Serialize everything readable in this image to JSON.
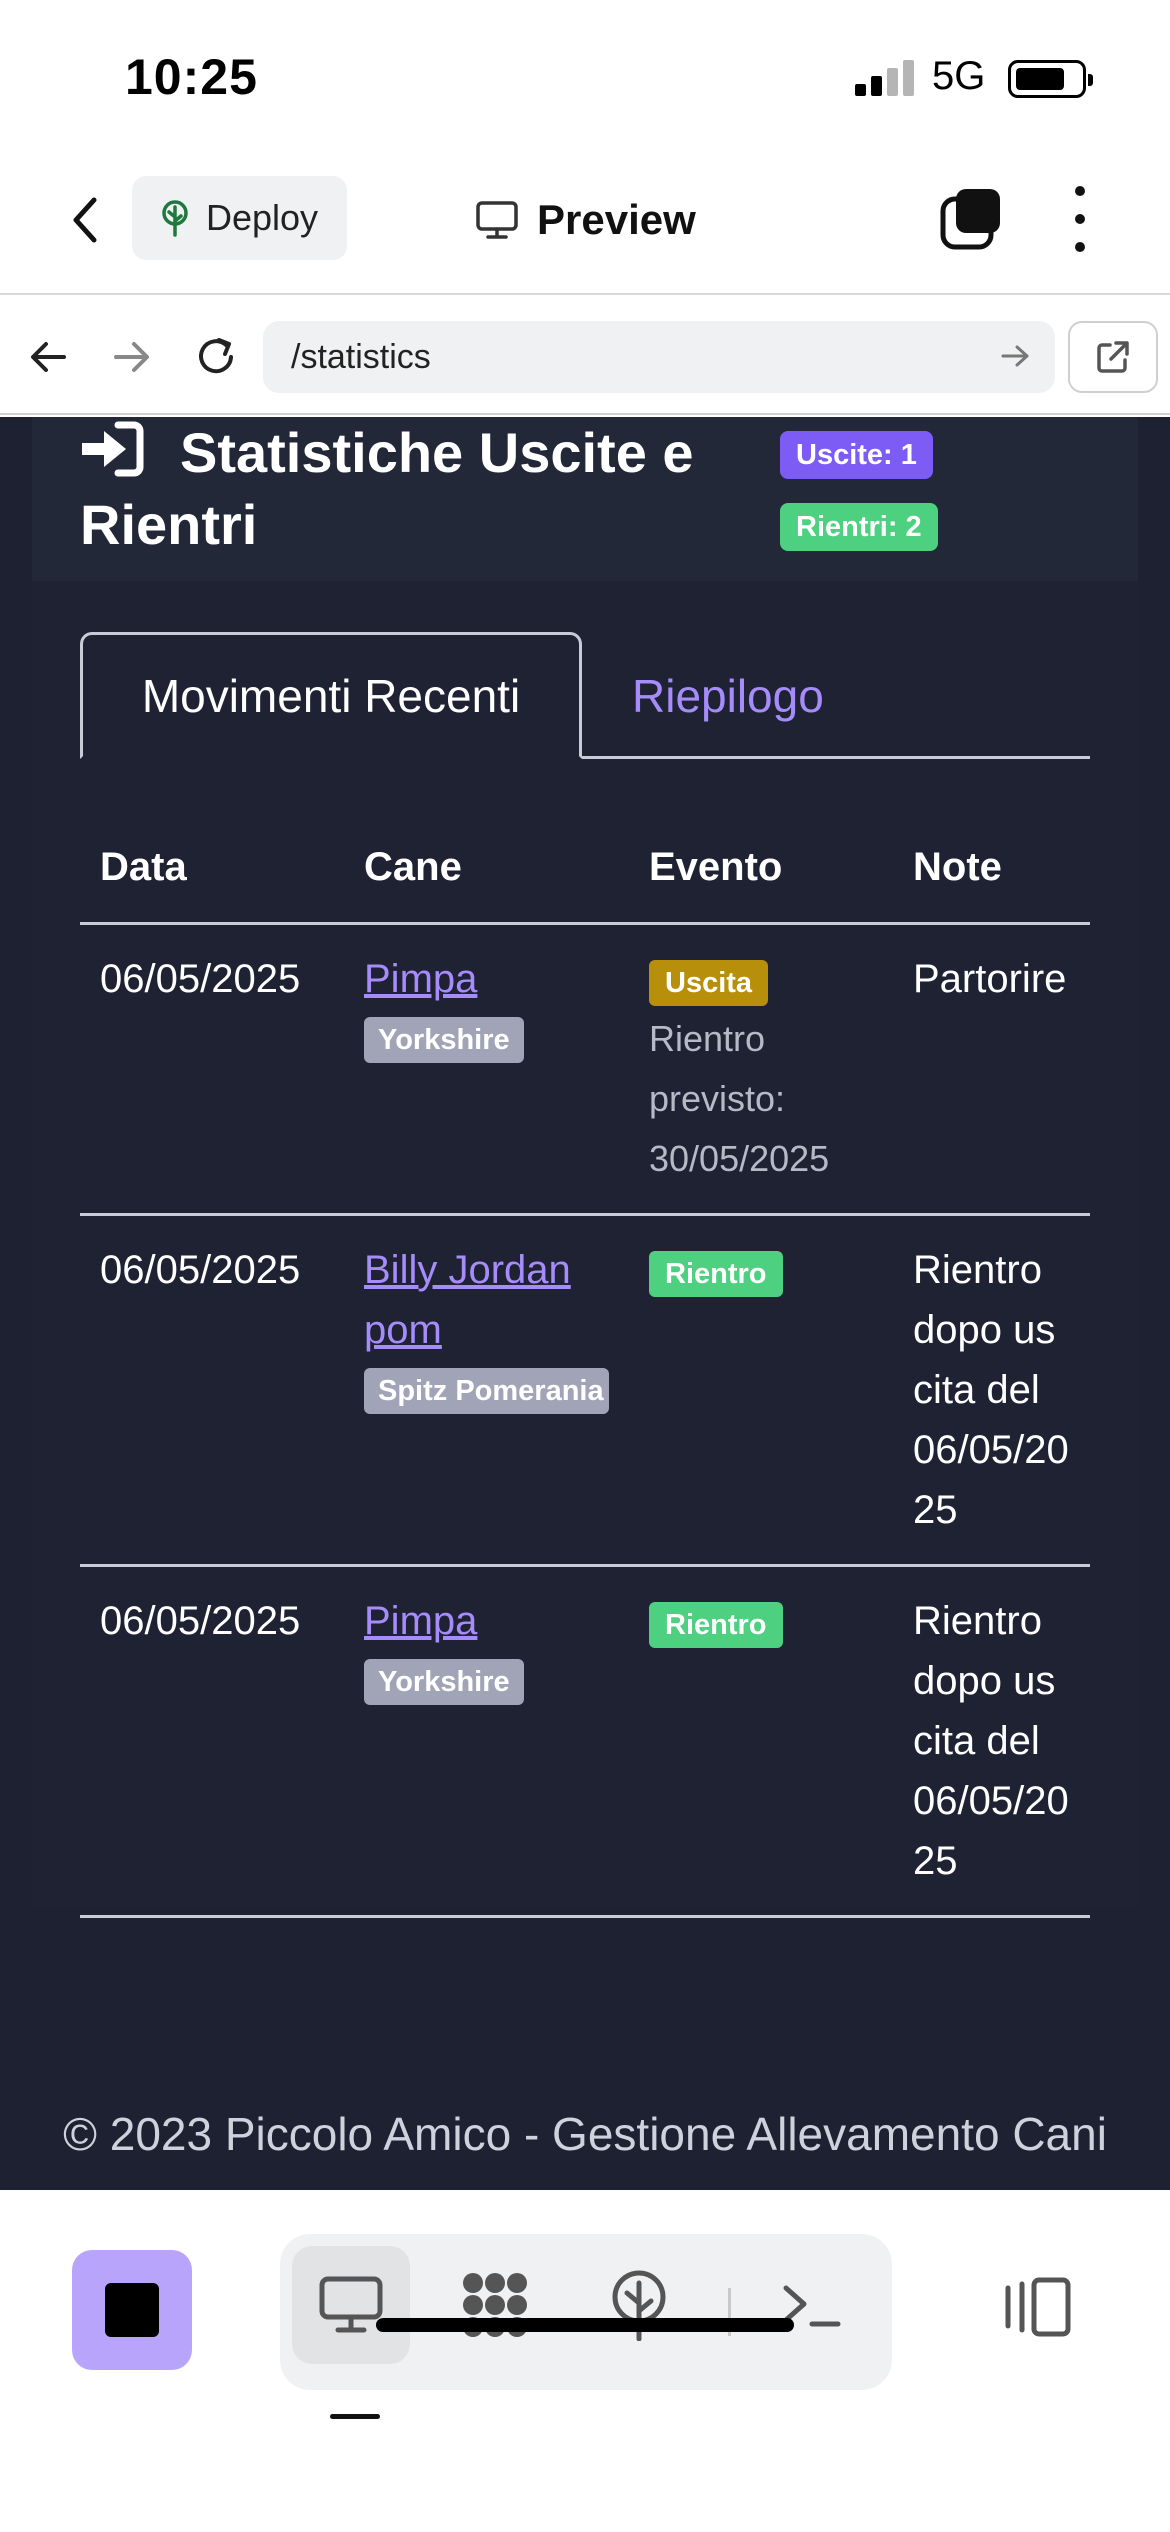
{
  "status_bar": {
    "time": "10:25",
    "network": "5G"
  },
  "app_toolbar": {
    "deploy_label": "Deploy",
    "preview_label": "Preview"
  },
  "browser": {
    "url": "/statistics"
  },
  "card": {
    "title": "Statistiche Uscite e Rientri",
    "badge_uscite": "Uscite: 1",
    "badge_rientri": "Rientri: 2"
  },
  "tabs": {
    "active": "Movimenti Recenti",
    "inactive": "Riepilogo"
  },
  "table": {
    "headers": [
      "Data",
      "Cane",
      "Evento",
      "Note"
    ],
    "rows": [
      {
        "date": "06/05/2025",
        "dog": "Pimpa",
        "breed": "Yorkshire",
        "event": "Uscita",
        "event_sub": "Rientro previsto: 30/05/2025",
        "note": "Partorire"
      },
      {
        "date": "06/05/2025",
        "dog": "Billy Jordan pom",
        "breed": "Spitz Pomerania",
        "event": "Rientro",
        "event_sub": "",
        "note": "Rientro dopo uscita del 06/05/2025"
      },
      {
        "date": "06/05/2025",
        "dog": "Pimpa",
        "breed": "Yorkshire",
        "event": "Rientro",
        "event_sub": "",
        "note": "Rientro dopo uscita del 06/05/2025"
      }
    ]
  },
  "footer": "© 2023 Piccolo Amico - Gestione Allevamento Cani",
  "colors": {
    "page_bg": "#1d2131",
    "accent": "#a68bfa",
    "badge_uscite": "#7c5cf5",
    "badge_rientri": "#4ed081",
    "badge_uscita_event": "#b88f0a",
    "breed_badge": "#a0a4b6"
  },
  "icons": {
    "back": "chevron-left-icon",
    "deploy": "tree-icon",
    "preview": "monitor-icon",
    "tabs_stack": "stack-icon",
    "menu": "kebab-icon",
    "title": "sign-in-icon",
    "bottom": [
      "stop-icon",
      "monitor-icon",
      "grid-icon",
      "deploy-icon",
      "terminal-icon",
      "panel-icon"
    ]
  }
}
